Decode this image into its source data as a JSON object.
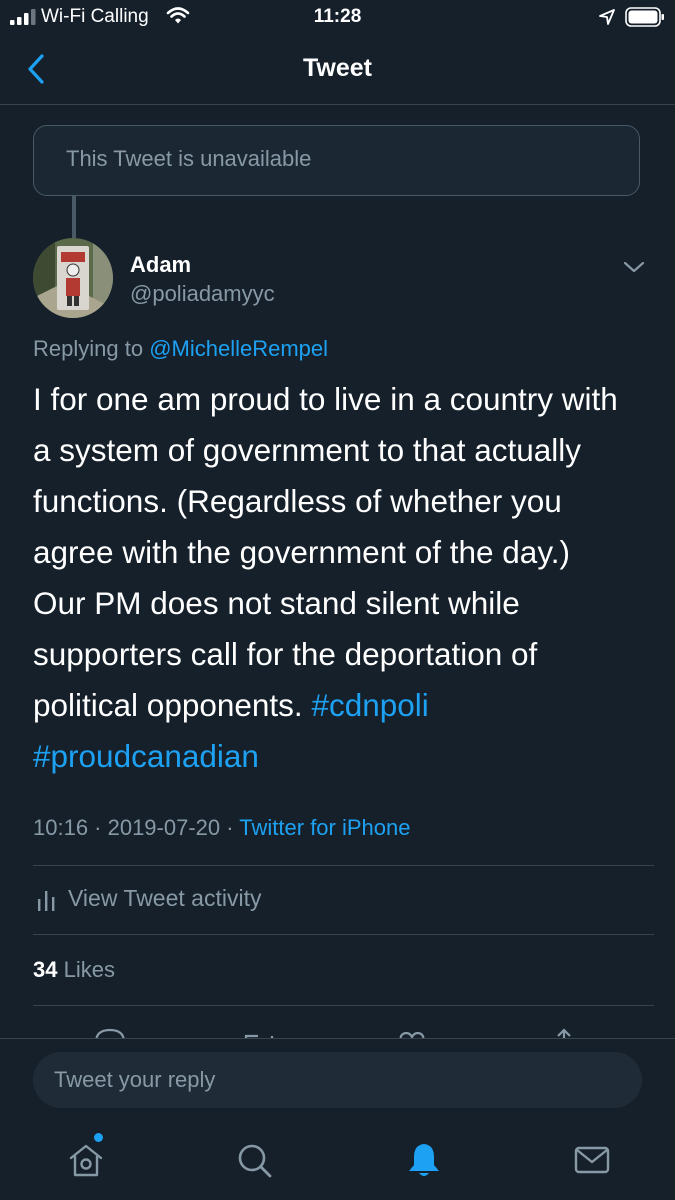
{
  "status_bar": {
    "carrier": "Wi-Fi Calling",
    "time": "11:28"
  },
  "nav": {
    "title": "Tweet"
  },
  "unavailable": {
    "text": "This Tweet is unavailable"
  },
  "tweet": {
    "author_name": "Adam",
    "author_handle": "@poliadamyyc",
    "replying_prefix": "Replying to ",
    "replying_to": "@MichelleRempel",
    "text_lines": [
      "I for one am proud to live in a country with",
      "a system of government to that actually",
      "functions. (Regardless of whether you",
      "agree with the government of the day.)",
      "Our PM does not stand silent while",
      "supporters call for the deportation of",
      "political opponents. "
    ],
    "hashtags": [
      "#cdnpoli",
      "#proudcanadian"
    ],
    "timestamp": "10:16 · 2019-07-20 · ",
    "source": "Twitter for iPhone"
  },
  "activity": {
    "label": "View Tweet activity"
  },
  "likes": {
    "count": "34",
    "label": " Likes"
  },
  "compose": {
    "placeholder": "Tweet your reply"
  },
  "tabs": [
    {
      "name": "home-icon"
    },
    {
      "name": "search-icon"
    },
    {
      "name": "notifications-icon",
      "active": true
    },
    {
      "name": "messages-icon"
    }
  ],
  "colors": {
    "background": "#15202b",
    "accent": "#1da1f2",
    "secondary_text": "#8899a6",
    "divider": "#38444d"
  }
}
